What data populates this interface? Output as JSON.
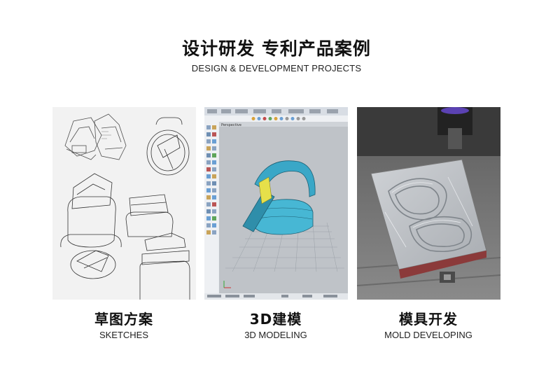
{
  "header": {
    "title": "设计研发 专利产品案例",
    "subtitle": "DESIGN & DEVELOPMENT PROJECTS"
  },
  "panels": [
    {
      "cn": "草图方案",
      "en": "SKETCHES"
    },
    {
      "cn": "3D建模",
      "en": "3D MODELING"
    },
    {
      "cn": "模具开发",
      "en": "MOLD DEVELOPING"
    }
  ],
  "cad": {
    "viewport_label": "Perspective"
  }
}
